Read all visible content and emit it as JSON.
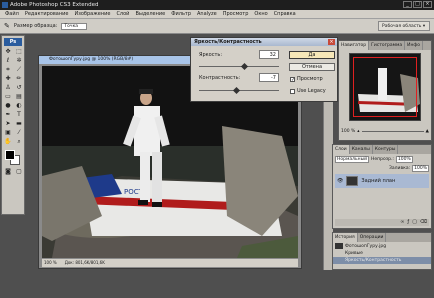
{
  "app": {
    "title": "Adobe Photoshop CS3 Extended",
    "logo": "Ps"
  },
  "window_controls": {
    "minimize": "_",
    "maximize": "□",
    "close": "×"
  },
  "menu": [
    "Файл",
    "Редактирование",
    "Изображение",
    "Слой",
    "Выделение",
    "Фильтр",
    "Analyze",
    "Просмотр",
    "Окно",
    "Справка"
  ],
  "options": {
    "sample_label": "Размер образца:",
    "sample_value": "Точка",
    "workspace": "Рабочая область"
  },
  "document": {
    "title": "ФотошопГуру.jpg @ 100% (RGB/8#)",
    "zoom": "100 %",
    "doc_info": "Док: 801,6K/801,6K",
    "banner_text": "РОСТО"
  },
  "dialog": {
    "title": "Яркость/Контрастность",
    "brightness_label": "Яркость:",
    "brightness_value": "32",
    "brightness_level": 0.57,
    "contrast_label": "Контрастность:",
    "contrast_value": "-7",
    "contrast_level": 0.47,
    "ok": "Да",
    "cancel": "Отмена",
    "preview_label": "Просмотр",
    "preview_checked": true,
    "legacy_label": "Use Legacy",
    "legacy_checked": false
  },
  "navigator": {
    "tabs": [
      "Навигатор",
      "Гистограмма",
      "Инфо"
    ],
    "zoom": "100 %"
  },
  "layers": {
    "tabs": [
      "Слои",
      "Каналы",
      "Контуры"
    ],
    "blend_mode": "Нормальный",
    "opacity_label": "Непрозр.:",
    "opacity": "100%",
    "fill_label": "Заливка:",
    "fill": "100%",
    "layer_name": "Задний план"
  },
  "history": {
    "tabs": [
      "История",
      "Операции"
    ],
    "items": [
      "ФотошопГуру.jpg",
      "Кривые",
      "Яркость/Контрастность"
    ]
  },
  "colors": {
    "titlebar": "#1e1e1e",
    "panel": "#cac7c0",
    "accent_red": "#e02020"
  }
}
